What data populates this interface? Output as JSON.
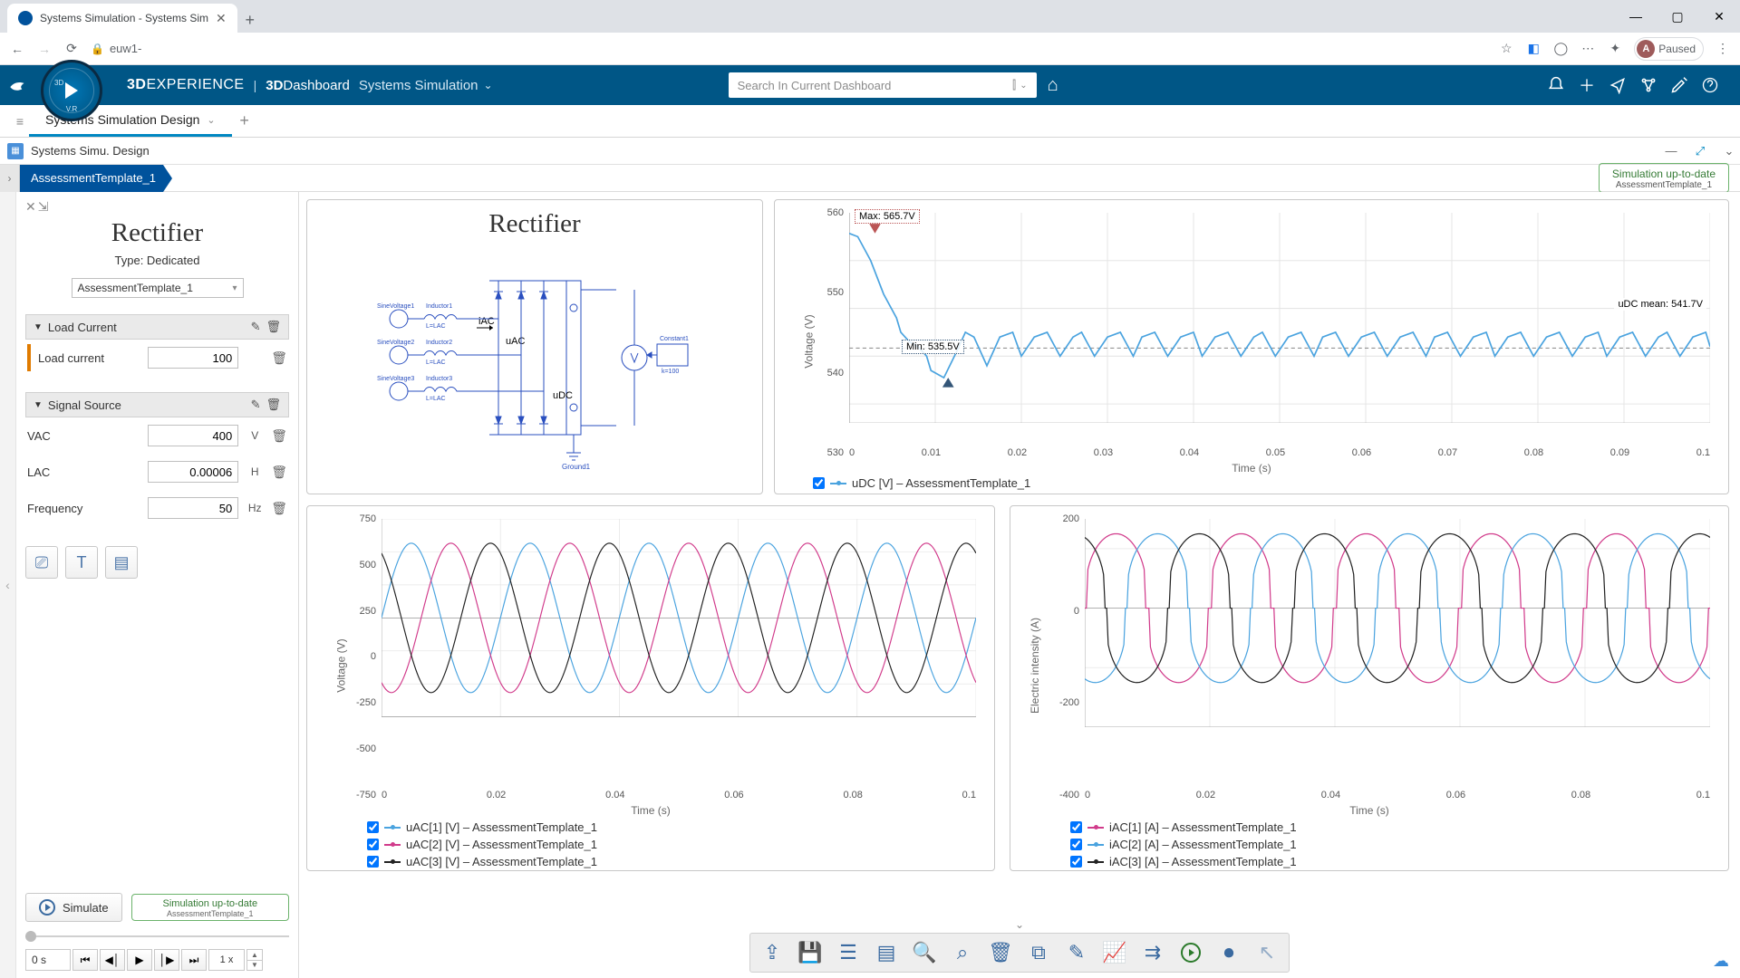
{
  "browser": {
    "tab_title": "Systems Simulation - Systems Sim",
    "url_host": "euw1-",
    "paused_label": "Paused",
    "avatar_initial": "A"
  },
  "app_bar": {
    "brand_prefix": "3D",
    "brand_main": "EXPERIENCE",
    "brand_sep": "|",
    "brand_dash_prefix": "3D",
    "brand_dash": "Dashboard",
    "app_name": "Systems Simulation",
    "search_placeholder": "Search In Current Dashboard",
    "compass_label_bottom": "V.R",
    "compass_label_tl": "3D"
  },
  "sub_tabs": {
    "active": "Systems Simulation Design"
  },
  "panel_title": "Systems Simu. Design",
  "breadcrumb": "AssessmentTemplate_1",
  "sim_status": {
    "line1": "Simulation up-to-date",
    "line2": "AssessmentTemplate_1"
  },
  "left": {
    "title": "Rectifier",
    "type_label": "Type: Dedicated",
    "template_select": "AssessmentTemplate_1",
    "section_load": "Load Current",
    "param_load_label": "Load current",
    "param_load_value": "100",
    "section_signal": "Signal Source",
    "vac_label": "VAC",
    "vac_value": "400",
    "vac_unit": "V",
    "lac_label": "LAC",
    "lac_value": "0.00006",
    "lac_unit": "H",
    "freq_label": "Frequency",
    "freq_value": "50",
    "freq_unit": "Hz",
    "simulate_btn": "Simulate",
    "sim_status": {
      "line1": "Simulation up-to-date",
      "line2": "AssessmentTemplate_1"
    },
    "time_display": "0 s",
    "speed_display": "1 x"
  },
  "schematic": {
    "title": "Rectifier",
    "labels": {
      "iac": "iAC",
      "uac": "uAC",
      "udc": "uDC",
      "ground": "Ground1",
      "const": "Constant1",
      "k": "k=100"
    },
    "src_labels": [
      "SineVoltage1",
      "SineVoltage2",
      "SineVoltage3"
    ],
    "ind_labels": [
      "Inductor1",
      "Inductor2",
      "Inductor3"
    ],
    "row_labels": [
      "L=LAC",
      "L=LAC",
      "L=LAC"
    ]
  },
  "chart_data": [
    {
      "id": "udc_plot",
      "type": "line",
      "xlabel": "Time (s)",
      "ylabel": "Voltage (V)",
      "xlim": [
        0,
        0.1
      ],
      "ylim": [
        526,
        570
      ],
      "xticks": [
        0,
        0.01,
        0.02,
        0.03,
        0.04,
        0.05,
        0.06,
        0.07,
        0.08,
        0.09,
        0.1
      ],
      "yticks": [
        530,
        540,
        550,
        560
      ],
      "series": [
        {
          "name": "uDC [V] – AssessmentTemplate_1",
          "color": "#4aa3df",
          "x": [
            0,
            0.001,
            0.0025,
            0.004,
            0.0055,
            0.006,
            0.007,
            0.008,
            0.009,
            0.0095,
            0.011,
            0.0125,
            0.0135,
            0.0145,
            0.016,
            0.0175,
            0.019,
            0.02,
            0.0215,
            0.023,
            0.0245,
            0.026,
            0.027,
            0.0285,
            0.03,
            0.0315,
            0.033,
            0.034,
            0.0355,
            0.037,
            0.0385,
            0.04,
            0.041,
            0.0425,
            0.044,
            0.0455,
            0.047,
            0.048,
            0.0495,
            0.051,
            0.0525,
            0.054,
            0.055,
            0.0565,
            0.058,
            0.0595,
            0.061,
            0.0625,
            0.064,
            0.0655,
            0.067,
            0.068,
            0.0695,
            0.071,
            0.0725,
            0.074,
            0.075,
            0.0765,
            0.078,
            0.0795,
            0.081,
            0.0825,
            0.084,
            0.0855,
            0.087,
            0.088,
            0.0895,
            0.091,
            0.0925,
            0.094,
            0.095,
            0.0965,
            0.098,
            0.0995,
            0.1
          ],
          "y": [
            565.7,
            565,
            560,
            553,
            548,
            545,
            543,
            542,
            540,
            537,
            535.5,
            541,
            545,
            544,
            538,
            544,
            545,
            540,
            544,
            545,
            540,
            544,
            545,
            540,
            544,
            545,
            540,
            544,
            545,
            540,
            544,
            545,
            540,
            544,
            545,
            540,
            544,
            545,
            540,
            544,
            545,
            540,
            544,
            545,
            540,
            544,
            545,
            540,
            544,
            545,
            540,
            544,
            545,
            540,
            544,
            545,
            540,
            544,
            545,
            540,
            544,
            545,
            540,
            544,
            545,
            540,
            544,
            545,
            540,
            544,
            545,
            540,
            544,
            545,
            542
          ]
        }
      ],
      "annotations": {
        "max": {
          "label": "Max: 565.7V",
          "x": 0.003,
          "y": 565.7
        },
        "min": {
          "label": "Min: 535.5V",
          "x": 0.0115,
          "y": 535.5
        },
        "mean": {
          "label": "uDC mean: 541.7V",
          "y": 541.7
        }
      }
    },
    {
      "id": "uac_plot",
      "type": "line",
      "xlabel": "Time (s)",
      "ylabel": "Voltage (V)",
      "xlim": [
        0,
        0.1
      ],
      "ylim": [
        -750,
        750
      ],
      "xticks": [
        0,
        0.02,
        0.04,
        0.06,
        0.08,
        0.1
      ],
      "yticks": [
        -750,
        -500,
        -250,
        0,
        250,
        500,
        750
      ],
      "period_s": 0.02,
      "amplitude": 566,
      "series": [
        {
          "name": "uAC[1] [V] – AssessmentTemplate_1",
          "color": "#4aa3df",
          "phase_deg": 0
        },
        {
          "name": "uAC[2] [V] – AssessmentTemplate_1",
          "color": "#d13b8b",
          "phase_deg": -120
        },
        {
          "name": "uAC[3] [V] – AssessmentTemplate_1",
          "color": "#222222",
          "phase_deg": 120
        }
      ]
    },
    {
      "id": "iac_plot",
      "type": "line",
      "xlabel": "Time (s)",
      "ylabel": "Electric intensity (A)",
      "xlim": [
        0,
        0.1
      ],
      "ylim": [
        -400,
        300
      ],
      "xticks": [
        0,
        0.02,
        0.04,
        0.06,
        0.08,
        0.1
      ],
      "yticks": [
        -400,
        -200,
        0,
        200
      ],
      "period_s": 0.02,
      "amplitude": 250,
      "series": [
        {
          "name": "iAC[1] [A] – AssessmentTemplate_1",
          "color": "#d13b8b",
          "phase_deg": 0
        },
        {
          "name": "iAC[2] [A] – AssessmentTemplate_1",
          "color": "#4aa3df",
          "phase_deg": -120
        },
        {
          "name": "iAC[3] [A] – AssessmentTemplate_1",
          "color": "#222222",
          "phase_deg": 120
        }
      ]
    }
  ]
}
